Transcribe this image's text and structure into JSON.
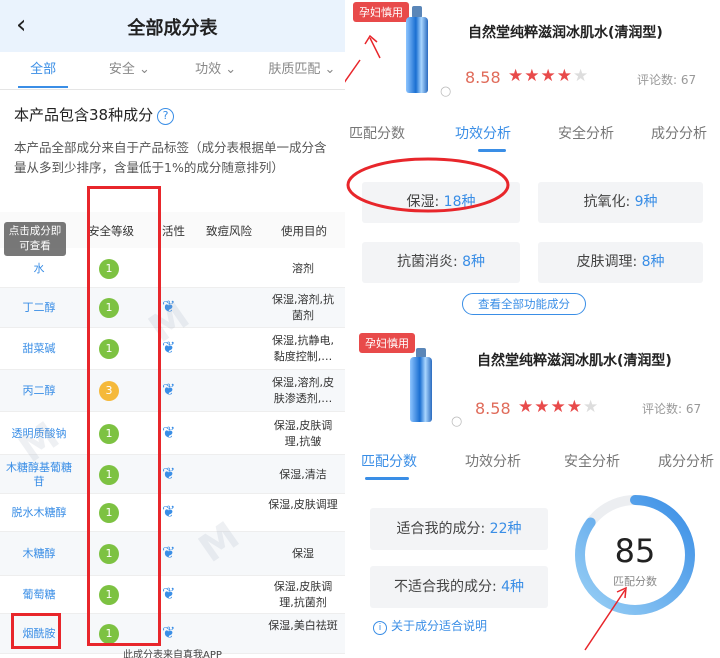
{
  "left": {
    "title": "全部成分表",
    "back_glyph": "‹",
    "tabs": [
      "全部",
      "安全",
      "功效",
      "肤质匹配"
    ],
    "info_title": "本产品包含38种成分",
    "info_desc": "本产品全部成分来自于产品标签（成分表根据单一成分含量从多到少排序，含量低于1%的成分随意排列）",
    "tooltip": "点击成分即可查看",
    "headers": {
      "safety": "安全等级",
      "active": "活性",
      "acne": "致痘风险",
      "purpose": "使用目的"
    },
    "rows": [
      {
        "name": "水",
        "level": "1",
        "color": "green",
        "active": false,
        "purpose": "溶剂"
      },
      {
        "name": "丁二醇",
        "level": "1",
        "color": "green",
        "active": true,
        "purpose": "保湿,溶剂,抗菌剂"
      },
      {
        "name": "甜菜碱",
        "level": "1",
        "color": "green",
        "active": true,
        "purpose": "保湿,抗静电,黏度控制,…"
      },
      {
        "name": "丙二醇",
        "level": "3",
        "color": "yellow",
        "active": true,
        "purpose": "保湿,溶剂,皮肤渗透剂,…"
      },
      {
        "name": "透明质酸钠",
        "level": "1",
        "color": "green",
        "active": true,
        "purpose": "保湿,皮肤调理,抗皱"
      },
      {
        "name": "木糖醇基葡糖苷",
        "level": "1",
        "color": "green",
        "active": true,
        "purpose": "保湿,清洁"
      },
      {
        "name": "脱水木糖醇",
        "level": "1",
        "color": "green",
        "active": true,
        "purpose": "保湿,皮肤调理"
      },
      {
        "name": "木糖醇",
        "level": "1",
        "color": "green",
        "active": true,
        "purpose": "保湿"
      },
      {
        "name": "葡萄糖",
        "level": "1",
        "color": "green",
        "active": true,
        "purpose": "保湿,皮肤调理,抗菌剂"
      },
      {
        "name": "烟酰胺",
        "level": "1",
        "color": "green",
        "active": true,
        "purpose": "保湿,美白祛斑"
      }
    ],
    "footer": "此成分表来自真我APP"
  },
  "right": {
    "pregnancy_badge": "孕妇慎用",
    "product_name": "自然堂纯粹滋润冰肌水(清润型)",
    "score": "8.58",
    "rating_stars": 4.5,
    "review_count": "评论数: 67",
    "tabs": [
      "匹配分数",
      "功效分析",
      "安全分析",
      "成分分析"
    ],
    "efficacy": [
      {
        "label": "保湿:",
        "value": "18种"
      },
      {
        "label": "抗氧化:",
        "value": "9种"
      },
      {
        "label": "抗菌消炎:",
        "value": "8种"
      },
      {
        "label": "皮肤调理:",
        "value": "8种"
      }
    ],
    "view_all": "查看全部功能成分",
    "match": [
      {
        "label": "适合我的成分:",
        "value": "22种"
      },
      {
        "label": "不适合我的成分:",
        "value": "4种"
      }
    ],
    "about": "关于成分适合说明",
    "gauge": {
      "value": "85",
      "label": "匹配分数",
      "fraction": 0.85
    }
  },
  "colors": {
    "accent": "#3a8ee6",
    "danger": "#e8262b",
    "safe_green": "#7dc242",
    "warn_yellow": "#f5b93a"
  }
}
